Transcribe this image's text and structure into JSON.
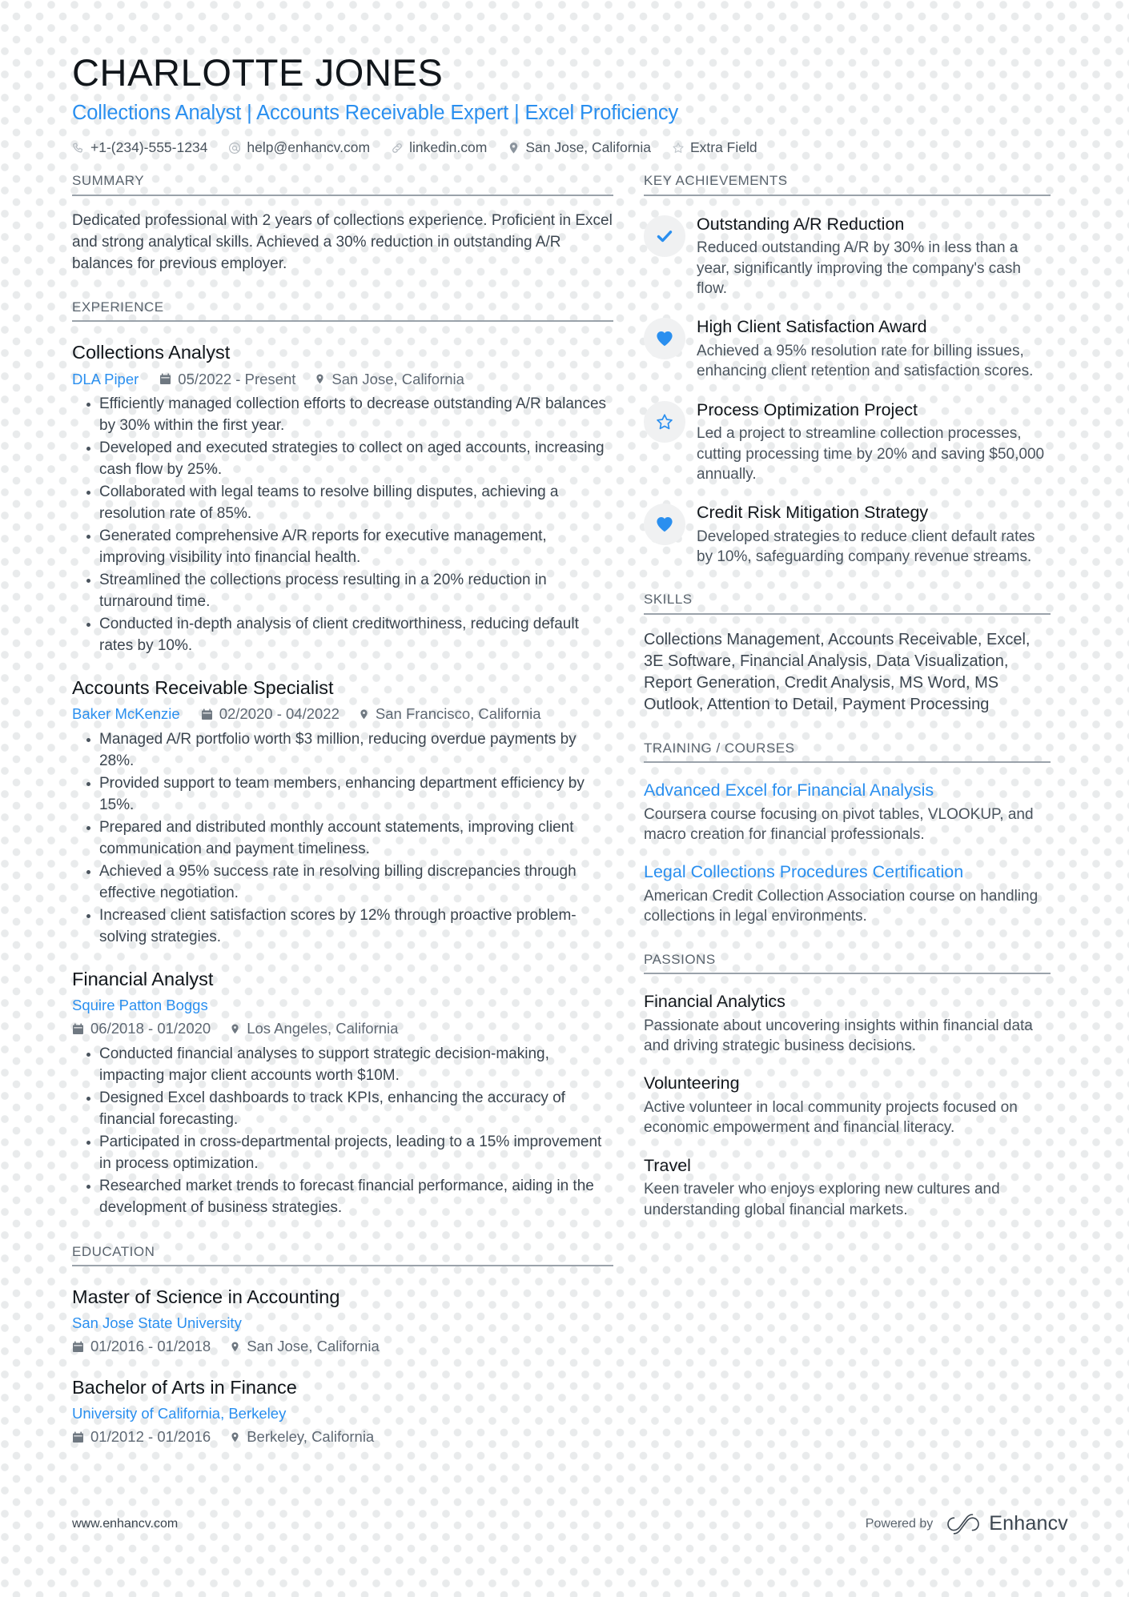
{
  "header": {
    "name": "CHARLOTTE JONES",
    "headline": "Collections Analyst | Accounts Receivable Expert | Excel Proficiency",
    "contacts": [
      {
        "icon": "phone-icon",
        "text": "+1-(234)-555-1234"
      },
      {
        "icon": "email-icon",
        "text": "help@enhancv.com"
      },
      {
        "icon": "link-icon",
        "text": "linkedin.com"
      },
      {
        "icon": "location-pin-icon",
        "text": "San Jose, California"
      },
      {
        "icon": "star-outline-icon",
        "text": "Extra Field"
      }
    ]
  },
  "summary": {
    "heading": "SUMMARY",
    "text": "Dedicated professional with 2 years of collections experience. Proficient in Excel and strong analytical skills. Achieved a 30% reduction in outstanding A/R balances for previous employer."
  },
  "experience": {
    "heading": "EXPERIENCE",
    "entries": [
      {
        "title": "Collections Analyst",
        "org": "DLA Piper",
        "dates": "05/2022 - Present",
        "location": "San Jose, California",
        "layout": "inline",
        "bullets": [
          "Efficiently managed collection efforts to decrease outstanding A/R balances by 30% within the first year.",
          "Developed and executed strategies to collect on aged accounts, increasing cash flow by 25%.",
          "Collaborated with legal teams to resolve billing disputes, achieving a resolution rate of 85%.",
          "Generated comprehensive A/R reports for executive management, improving visibility into financial health.",
          "Streamlined the collections process resulting in a 20% reduction in turnaround time.",
          "Conducted in-depth analysis of client creditworthiness, reducing default rates by 10%."
        ]
      },
      {
        "title": "Accounts Receivable Specialist",
        "org": "Baker McKenzie",
        "dates": "02/2020 - 04/2022",
        "location": "San Francisco, California",
        "layout": "inline",
        "bullets": [
          "Managed A/R portfolio worth $3 million, reducing overdue payments by 28%.",
          "Provided support to team members, enhancing department efficiency by 15%.",
          "Prepared and distributed monthly account statements, improving client communication and payment timeliness.",
          "Achieved a 95% success rate in resolving billing discrepancies through effective negotiation.",
          "Increased client satisfaction scores by 12% through proactive problem-solving strategies."
        ]
      },
      {
        "title": "Financial Analyst",
        "org": "Squire Patton Boggs",
        "dates": "06/2018 - 01/2020",
        "location": "Los Angeles, California",
        "layout": "stacked",
        "bullets": [
          "Conducted financial analyses to support strategic decision-making, impacting major client accounts worth $10M.",
          "Designed Excel dashboards to track KPIs, enhancing the accuracy of financial forecasting.",
          "Participated in cross-departmental projects, leading to a 15% improvement in process optimization.",
          "Researched market trends to forecast financial performance, aiding in the development of business strategies."
        ]
      }
    ]
  },
  "education": {
    "heading": "EDUCATION",
    "entries": [
      {
        "title": "Master of Science in Accounting",
        "org": "San Jose State University",
        "dates": "01/2016 - 01/2018",
        "location": "San Jose, California"
      },
      {
        "title": "Bachelor of Arts in Finance",
        "org": "University of California, Berkeley",
        "dates": "01/2012 - 01/2016",
        "location": "Berkeley, California"
      }
    ]
  },
  "key_achievements": {
    "heading": "KEY ACHIEVEMENTS",
    "items": [
      {
        "icon": "check-icon",
        "title": "Outstanding A/R Reduction",
        "desc": "Reduced outstanding A/R by 30% in less than a year, significantly improving the company's cash flow."
      },
      {
        "icon": "heart-filled-icon",
        "title": "High Client Satisfaction Award",
        "desc": "Achieved a 95% resolution rate for billing issues, enhancing client retention and satisfaction scores."
      },
      {
        "icon": "star-outline-icon",
        "title": "Process Optimization Project",
        "desc": "Led a project to streamline collection processes, cutting processing time by 20% and saving $50,000 annually."
      },
      {
        "icon": "heart-filled-icon",
        "title": "Credit Risk Mitigation Strategy",
        "desc": "Developed strategies to reduce client default rates by 10%, safeguarding company revenue streams."
      }
    ]
  },
  "skills": {
    "heading": "SKILLS",
    "text": "Collections Management, Accounts Receivable, Excel, 3E Software, Financial Analysis, Data Visualization, Report Generation, Credit Analysis, MS Word, MS Outlook, Attention to Detail, Payment Processing"
  },
  "training": {
    "heading": "TRAINING / COURSES",
    "items": [
      {
        "title": "Advanced Excel for Financial Analysis",
        "desc": "Coursera course focusing on pivot tables, VLOOKUP, and macro creation for financial professionals."
      },
      {
        "title": "Legal Collections Procedures Certification",
        "desc": "American Credit Collection Association course on handling collections in legal environments."
      }
    ]
  },
  "passions": {
    "heading": "PASSIONS",
    "items": [
      {
        "title": "Financial Analytics",
        "desc": "Passionate about uncovering insights within financial data and driving strategic business decisions."
      },
      {
        "title": "Volunteering",
        "desc": "Active volunteer in local community projects focused on economic empowerment and financial literacy."
      },
      {
        "title": "Travel",
        "desc": "Keen traveler who enjoys exploring new cultures and understanding global financial markets."
      }
    ]
  },
  "footer": {
    "url": "www.enhancv.com",
    "powered_by": "Powered by",
    "brand": "Enhancv"
  },
  "colors": {
    "accent": "#2a8fef",
    "heading": "#11161b",
    "body": "#3b454f",
    "muted": "#5a646e",
    "rule": "#9aa2aa",
    "badge_bg": "#f0f1f2",
    "dot": "#e9ebec"
  }
}
